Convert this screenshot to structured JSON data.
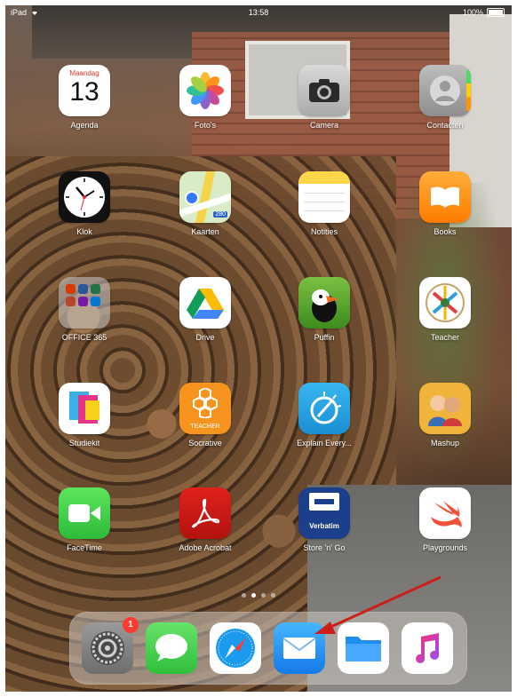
{
  "status_bar": {
    "device": "iPad",
    "time": "13:58",
    "battery": "100%"
  },
  "apps": [
    {
      "label": "Agenda",
      "icon": "calendar-icon",
      "weekday": "Maandag",
      "day": "13"
    },
    {
      "label": "Foto's",
      "icon": "photos-icon"
    },
    {
      "label": "Camera",
      "icon": "camera-icon"
    },
    {
      "label": "Contacten",
      "icon": "contacts-icon"
    },
    {
      "label": "Klok",
      "icon": "clock-icon"
    },
    {
      "label": "Kaarten",
      "icon": "maps-icon",
      "road_number": "280"
    },
    {
      "label": "Notities",
      "icon": "notes-icon"
    },
    {
      "label": "Books",
      "icon": "books-icon"
    },
    {
      "label": "OFFICE 365",
      "icon": "office-folder-icon"
    },
    {
      "label": "Drive",
      "icon": "drive-icon"
    },
    {
      "label": "Puffin",
      "icon": "puffin-icon"
    },
    {
      "label": "Teacher",
      "icon": "teacher-icon"
    },
    {
      "label": "Studiekit",
      "icon": "studiekit-icon"
    },
    {
      "label": "Socrative",
      "icon": "socrative-icon",
      "badge_text": "TEACHER"
    },
    {
      "label": "Explain Every...",
      "icon": "explain-everything-icon"
    },
    {
      "label": "Mashup",
      "icon": "mashup-icon"
    },
    {
      "label": "FaceTime",
      "icon": "facetime-icon"
    },
    {
      "label": "Adobe Acrobat",
      "icon": "acrobat-icon"
    },
    {
      "label": "Store 'n' Go",
      "icon": "verbatim-icon",
      "brand": "Verbatim"
    },
    {
      "label": "Playgrounds",
      "icon": "swift-icon"
    }
  ],
  "page_dots": {
    "count": 4,
    "active_index": 1
  },
  "dock": [
    {
      "name": "settings",
      "icon": "settings-icon",
      "badge": "1"
    },
    {
      "name": "messages",
      "icon": "messages-icon"
    },
    {
      "name": "safari",
      "icon": "safari-icon"
    },
    {
      "name": "mail",
      "icon": "mail-icon"
    },
    {
      "name": "files",
      "icon": "files-icon"
    },
    {
      "name": "music",
      "icon": "music-icon"
    }
  ],
  "annotation": {
    "type": "arrow",
    "color": "#cc1f1a",
    "points_to": "mail"
  }
}
